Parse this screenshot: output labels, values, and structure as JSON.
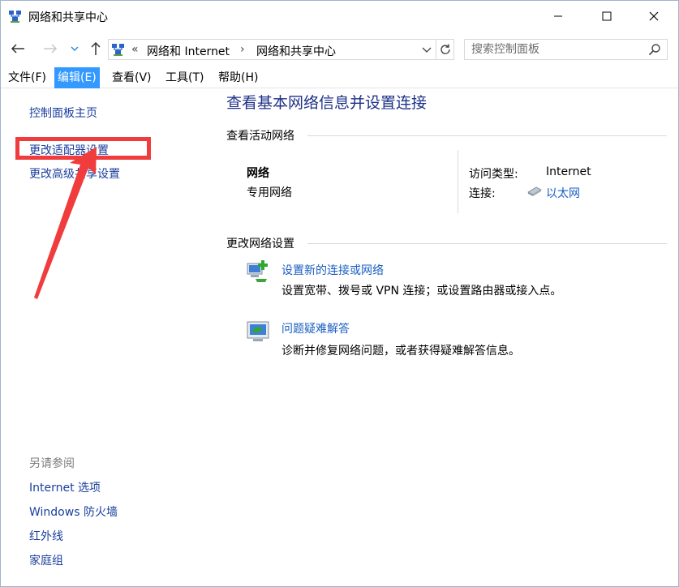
{
  "window": {
    "title": "网络和共享中心"
  },
  "address_bar": {
    "chevron": "«",
    "crumbs": [
      "网络和 Internet",
      "网络和共享中心"
    ],
    "separator": "›"
  },
  "search": {
    "placeholder": "搜索控制面板"
  },
  "menu": {
    "items": [
      "文件(F)",
      "编辑(E)",
      "查看(V)",
      "工具(T)",
      "帮助(H)"
    ],
    "active": "编辑(E)"
  },
  "left_pane": {
    "home_link": "控制面板主页",
    "adapter_link": "更改适配器设置",
    "advanced_link": "更改高级共享设置",
    "see_also_title": "另请参阅",
    "see_also": [
      "Internet 选项",
      "Windows 防火墙",
      "红外线",
      "家庭组"
    ]
  },
  "main": {
    "title": "查看基本网络信息并设置连接",
    "active_networks_title": "查看活动网络",
    "network": {
      "name": "网络",
      "type": "专用网络",
      "access_type_label": "访问类型:",
      "access_type_value": "Internet",
      "connection_label": "连接:",
      "connection_value": "以太网"
    },
    "change_settings_title": "更改网络设置",
    "tasks": [
      {
        "link": "设置新的连接或网络",
        "desc": "设置宽带、拨号或 VPN 连接；或设置路由器或接入点。"
      },
      {
        "link": "问题疑难解答",
        "desc": "诊断并修复网络问题，或者获得疑难解答信息。"
      }
    ]
  },
  "colors": {
    "link_blue": "#1a5fc1",
    "title_blue": "#1e3287",
    "menu_active": "#3399ff",
    "annotation_red": "#f03c3c"
  }
}
